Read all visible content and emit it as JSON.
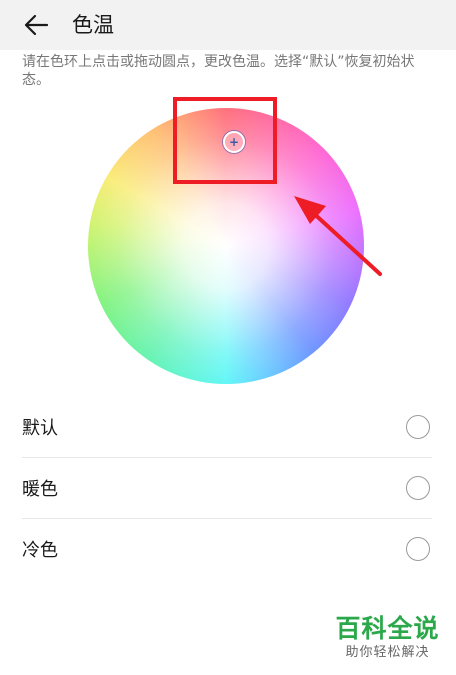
{
  "header": {
    "back_icon": "arrow-left-icon",
    "title": "色温"
  },
  "description": "请在色环上点击或拖动圆点，更改色温。选择“默认”恢复初始状态。",
  "color_wheel": {
    "handle_glyph": "+",
    "annotation_color": "#ee1c25"
  },
  "options": [
    {
      "label": "默认",
      "selected": false
    },
    {
      "label": "暖色",
      "selected": false
    },
    {
      "label": "冷色",
      "selected": false
    }
  ],
  "watermark": {
    "title": "百科全说",
    "subtitle": "助你轻松解决",
    "color": "#2aa84a"
  }
}
